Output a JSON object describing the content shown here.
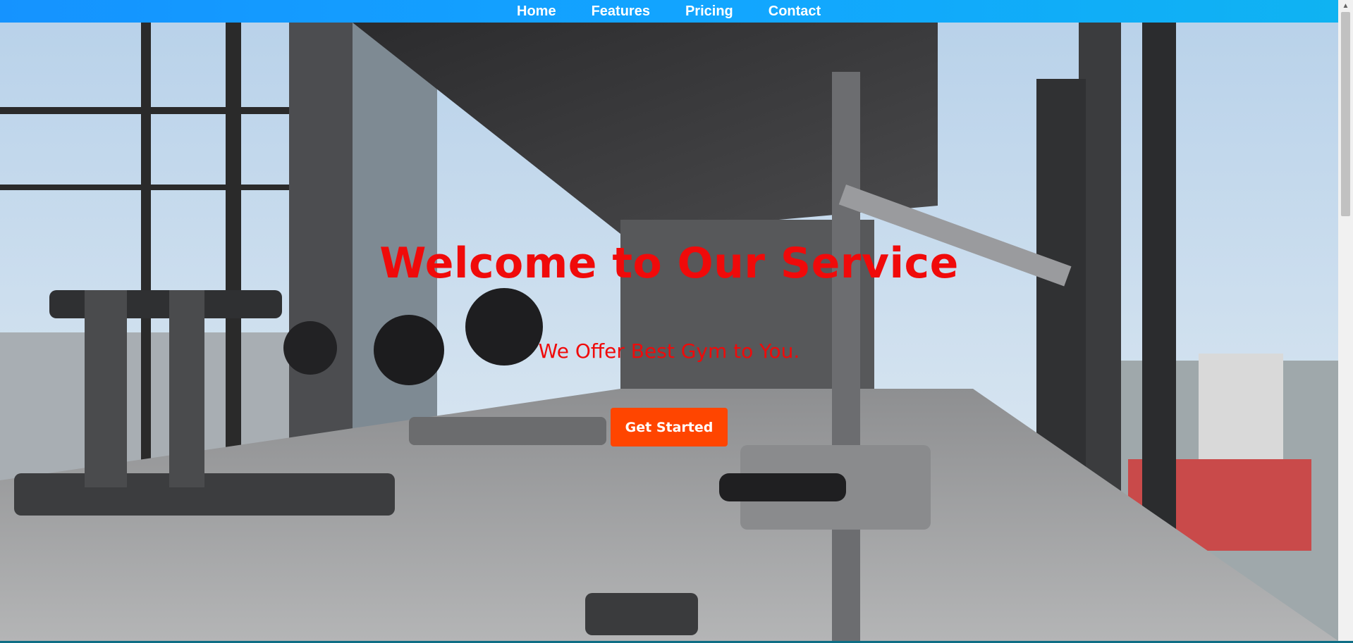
{
  "nav": {
    "items": [
      {
        "label": "Home"
      },
      {
        "label": "Features"
      },
      {
        "label": "Pricing"
      },
      {
        "label": "Contact"
      }
    ]
  },
  "hero": {
    "title": "Welcome to Our Service",
    "subtitle": "We Offer Best Gym to You.",
    "cta_label": "Get Started",
    "image_description": "gym-interior-photo"
  },
  "colors": {
    "nav_bg": "#12a6ff",
    "heading_red": "#f00a0a",
    "cta_bg": "#ff4500"
  },
  "scrollbar": {
    "up_arrow_icon": "triangle-up-icon"
  }
}
